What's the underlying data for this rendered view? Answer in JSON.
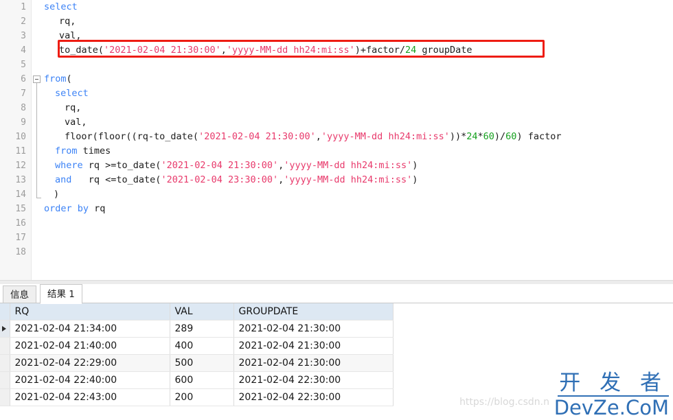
{
  "editor": {
    "line_numbers": [
      "1",
      "2",
      "3",
      "4",
      "5",
      "6",
      "7",
      "8",
      "9",
      "10",
      "11",
      "12",
      "13",
      "14",
      "15",
      "16",
      "17",
      "18"
    ],
    "highlight_box_color": "#ee1c12",
    "colors": {
      "keyword": "#3b82f6",
      "string": "#e8396b",
      "number": "#15a01e",
      "plain": "#1c1c1c",
      "gutter_text": "#9b9b9b",
      "gutter_bg": "#f7f7f7"
    },
    "lines": [
      {
        "n": "1",
        "indent": 0,
        "tokens": [
          {
            "t": "kw",
            "v": "select"
          }
        ]
      },
      {
        "n": "2",
        "indent": 22,
        "tokens": [
          {
            "t": "pln",
            "v": "rq,"
          }
        ]
      },
      {
        "n": "3",
        "indent": 22,
        "tokens": [
          {
            "t": "pln",
            "v": "val,"
          }
        ]
      },
      {
        "n": "4",
        "indent": 22,
        "tokens": [
          {
            "t": "pln",
            "v": "to_date("
          },
          {
            "t": "str",
            "v": "'2021-02-04 21:30:00'"
          },
          {
            "t": "pln",
            "v": ","
          },
          {
            "t": "str",
            "v": "'yyyy-MM-dd hh24:mi:ss'"
          },
          {
            "t": "pln",
            "v": ")+factor/"
          },
          {
            "t": "num",
            "v": "24"
          },
          {
            "t": "pln",
            "v": " groupDate"
          }
        ]
      },
      {
        "n": "5",
        "indent": 0,
        "tokens": []
      },
      {
        "n": "6",
        "indent": 0,
        "tokens": [
          {
            "t": "kw",
            "v": "from"
          },
          {
            "t": "pln",
            "v": "("
          }
        ]
      },
      {
        "n": "7",
        "indent": 16,
        "tokens": [
          {
            "t": "kw",
            "v": "select"
          }
        ]
      },
      {
        "n": "8",
        "indent": 30,
        "tokens": [
          {
            "t": "pln",
            "v": "rq,"
          }
        ]
      },
      {
        "n": "9",
        "indent": 30,
        "tokens": [
          {
            "t": "pln",
            "v": "val,"
          }
        ]
      },
      {
        "n": "10",
        "indent": 30,
        "tokens": [
          {
            "t": "pln",
            "v": "floor(floor((rq-to_date("
          },
          {
            "t": "str",
            "v": "'2021-02-04 21:30:00'"
          },
          {
            "t": "pln",
            "v": ","
          },
          {
            "t": "str",
            "v": "'yyyy-MM-dd hh24:mi:ss'"
          },
          {
            "t": "pln",
            "v": "))*"
          },
          {
            "t": "num",
            "v": "24"
          },
          {
            "t": "pln",
            "v": "*"
          },
          {
            "t": "num",
            "v": "60"
          },
          {
            "t": "pln",
            "v": ")/"
          },
          {
            "t": "num",
            "v": "60"
          },
          {
            "t": "pln",
            "v": ") factor"
          }
        ]
      },
      {
        "n": "11",
        "indent": 16,
        "tokens": [
          {
            "t": "kw",
            "v": "from"
          },
          {
            "t": "pln",
            "v": " times"
          }
        ]
      },
      {
        "n": "12",
        "indent": 16,
        "tokens": [
          {
            "t": "kw",
            "v": "where"
          },
          {
            "t": "pln",
            "v": " rq >=to_date("
          },
          {
            "t": "str",
            "v": "'2021-02-04 21:30:00'"
          },
          {
            "t": "pln",
            "v": ","
          },
          {
            "t": "str",
            "v": "'yyyy-MM-dd hh24:mi:ss'"
          },
          {
            "t": "pln",
            "v": ")"
          }
        ]
      },
      {
        "n": "13",
        "indent": 16,
        "tokens": [
          {
            "t": "kw",
            "v": "and"
          },
          {
            "t": "pln",
            "v": "   rq <=to_date("
          },
          {
            "t": "str",
            "v": "'2021-02-04 23:30:00'"
          },
          {
            "t": "pln",
            "v": ","
          },
          {
            "t": "str",
            "v": "'yyyy-MM-dd hh24:mi:ss'"
          },
          {
            "t": "pln",
            "v": ")"
          }
        ]
      },
      {
        "n": "14",
        "indent": 14,
        "tokens": [
          {
            "t": "pln",
            "v": ")"
          }
        ]
      },
      {
        "n": "15",
        "indent": 0,
        "tokens": [
          {
            "t": "kw",
            "v": "order by"
          },
          {
            "t": "pln",
            "v": " rq"
          }
        ]
      },
      {
        "n": "16",
        "indent": 0,
        "tokens": []
      },
      {
        "n": "17",
        "indent": 0,
        "tokens": []
      },
      {
        "n": "18",
        "indent": 0,
        "tokens": []
      }
    ]
  },
  "result_panel": {
    "tabs": [
      {
        "id": "info",
        "label": "信息",
        "active": false
      },
      {
        "id": "result",
        "label": "结果 1",
        "active": true
      }
    ],
    "grid": {
      "columns": [
        "RQ",
        "VAL",
        "GROUPDATE"
      ],
      "rows": [
        {
          "selected": true,
          "cells": [
            "2021-02-04 21:34:00",
            "289",
            "2021-02-04 21:30:00"
          ]
        },
        {
          "selected": false,
          "cells": [
            "2021-02-04 21:40:00",
            "400",
            "2021-02-04 21:30:00"
          ]
        },
        {
          "selected": false,
          "cells": [
            "2021-02-04 22:29:00",
            "500",
            "2021-02-04 21:30:00"
          ]
        },
        {
          "selected": false,
          "cells": [
            "2021-02-04 22:40:00",
            "600",
            "2021-02-04 22:30:00"
          ]
        },
        {
          "selected": false,
          "cells": [
            "2021-02-04 22:43:00",
            "200",
            "2021-02-04 22:30:00"
          ]
        }
      ]
    }
  },
  "watermark": {
    "cn": "开 发 者",
    "en": "DevZe.CoM",
    "url": "https://blog.csdn.n",
    "color": "#2f6fb5"
  }
}
